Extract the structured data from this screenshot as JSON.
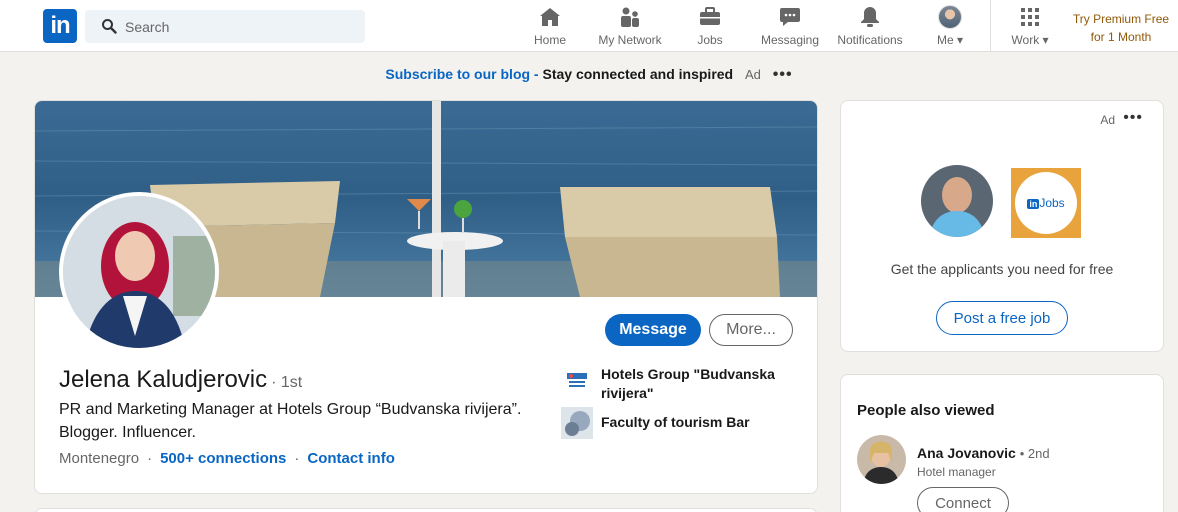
{
  "nav": {
    "logo": "in",
    "search_placeholder": "Search",
    "items": [
      {
        "label": "Home",
        "icon": "home-icon"
      },
      {
        "label": "My Network",
        "icon": "network-icon"
      },
      {
        "label": "Jobs",
        "icon": "briefcase-icon"
      },
      {
        "label": "Messaging",
        "icon": "messaging-icon"
      },
      {
        "label": "Notifications",
        "icon": "bell-icon"
      },
      {
        "label": "Me",
        "icon": "avatar"
      },
      {
        "label": "Work",
        "icon": "grid-icon"
      }
    ],
    "premium": "Try Premium Free for 1 Month"
  },
  "ad_banner": {
    "link": "Subscribe to our blog -",
    "text": "Stay connected and inspired",
    "ad": "Ad",
    "more": "•••"
  },
  "profile": {
    "name": "Jelena Kaludjerovic",
    "degree": "· 1st",
    "headline": "PR and Marketing Manager at Hotels Group “Budvanska rivijera”. Blogger. Influencer.",
    "location": "Montenegro",
    "sep": "·",
    "connections": "500+ connections",
    "contact": "Contact info",
    "message_button": "Message",
    "more_button": "More...",
    "experience": [
      {
        "org": "Hotels Group \"Budvanska rivijera\""
      },
      {
        "org": "Faculty of tourism Bar"
      }
    ]
  },
  "ad_card": {
    "ad": "Ad",
    "more": "•••",
    "jobs_logo_in": "in",
    "jobs_logo_text": "Jobs",
    "text": "Get the applicants you need for free",
    "button": "Post a free job"
  },
  "people_also_viewed": {
    "title": "People also viewed",
    "people": [
      {
        "name": "Ana Jovanovic",
        "degree": "• 2nd",
        "role": "Hotel manager",
        "button": "Connect"
      }
    ]
  },
  "colors": {
    "brand": "#0a66c2",
    "background": "#f3f2ef",
    "premium": "#915907",
    "jobs_accent": "#e8a33d"
  }
}
